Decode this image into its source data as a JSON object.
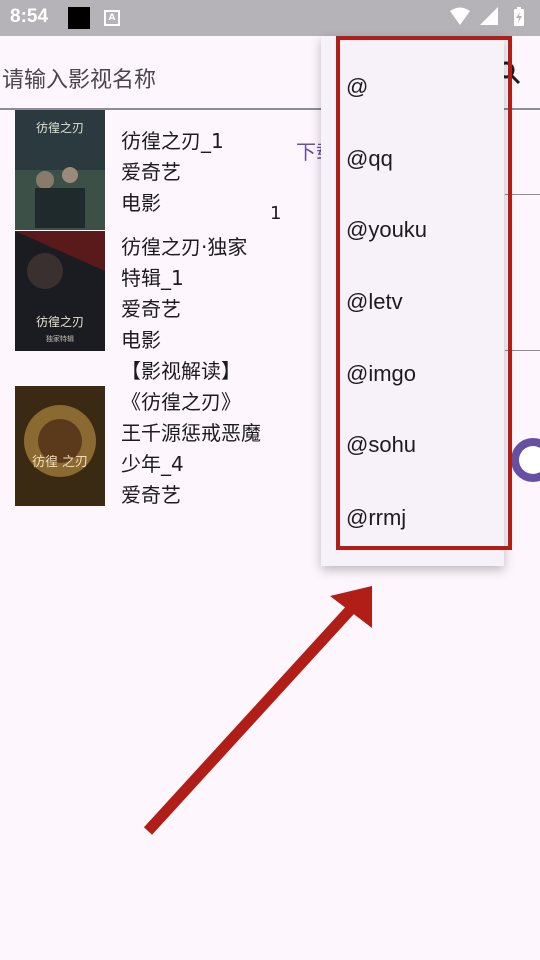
{
  "status_bar": {
    "time": "8:54",
    "a_icon_label": "A",
    "icons": [
      "square-icon",
      "a-icon",
      "wifi-icon",
      "signal-icon",
      "battery-icon"
    ]
  },
  "search": {
    "placeholder": "请输入影视名称"
  },
  "results": [
    {
      "lines": [
        "彷徨之刃_1",
        "爱奇艺",
        "电影"
      ]
    },
    {
      "lines": [
        "彷徨之刃·独家",
        "特辑_1",
        "爱奇艺",
        "电影"
      ]
    },
    {
      "lines": [
        "【影视解读】",
        "《彷徨之刃》",
        "王千源惩戒恶魔",
        "少年_4",
        "爱奇艺"
      ]
    }
  ],
  "side": {
    "download_label": "下载",
    "count": "1"
  },
  "menu": {
    "items": [
      "@",
      "@qq",
      "@youku",
      "@letv",
      "@imgo",
      "@sohu",
      "@rrmj"
    ]
  },
  "colors": {
    "accent": "#6750a4",
    "highlight": "#b01e17",
    "statusbar": "#b5b3b8"
  }
}
